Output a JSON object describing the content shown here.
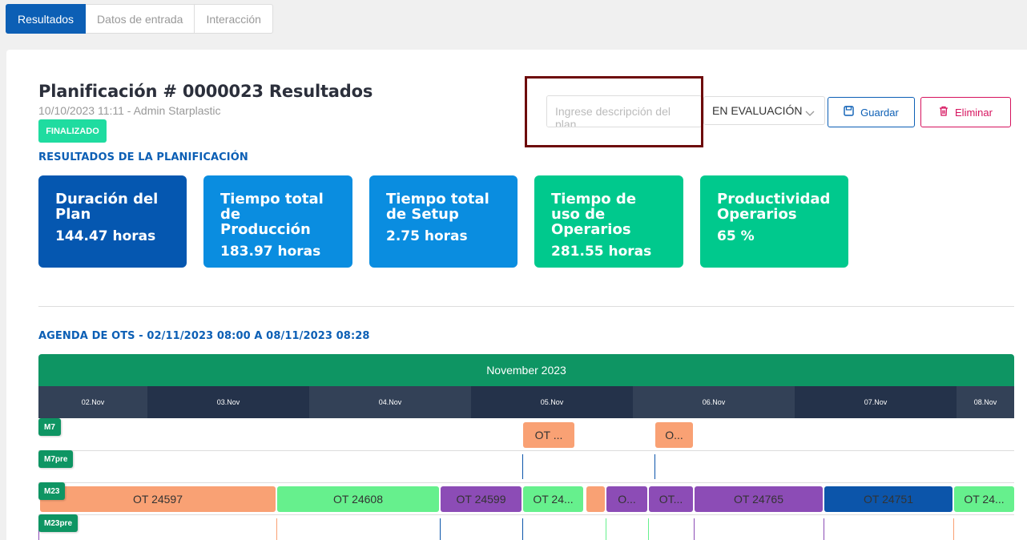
{
  "tabs": [
    {
      "label": "Resultados"
    },
    {
      "label": "Datos de entrada"
    },
    {
      "label": "Interacción"
    }
  ],
  "header": {
    "title": "Planificación # 0000023 Resultados",
    "subtitle": "10/10/2023 11:11 - Admin Starplastic",
    "badge": "FINALIZADO"
  },
  "description": {
    "placeholder": "Ingrese descripción del plan",
    "value": ""
  },
  "status_select": {
    "value": "EN EVALUACIÓN"
  },
  "buttons": {
    "save": "Guardar",
    "delete": "Eliminar"
  },
  "results": {
    "section_label": "RESULTADOS DE LA PLANIFICACIÓN",
    "cards": [
      {
        "title": "Duración del Plan",
        "value": "144.47 horas",
        "color": "#0557b0"
      },
      {
        "title": "Tiempo total de Producción",
        "value": "183.97 horas",
        "color": "#0a8de0"
      },
      {
        "title": "Tiempo total de Setup",
        "value": "2.75 horas",
        "color": "#0a8de0"
      },
      {
        "title": "Tiempo de uso de Operarios",
        "value": "281.55 horas",
        "color": "#00c98d"
      },
      {
        "title": "Productividad Operarios",
        "value": "65 %",
        "color": "#00c98d"
      }
    ]
  },
  "agenda": {
    "section_label": "AGENDA DE OTS - 02/11/2023 08:00 A 08/11/2023 08:28",
    "month": "November 2023",
    "days": [
      "02.Nov",
      "03.Nov",
      "04.Nov",
      "05.Nov",
      "06.Nov",
      "07.Nov",
      "08.Nov"
    ],
    "machines": [
      "M7",
      "M7pre",
      "M23",
      "M23pre"
    ],
    "m7_bars": [
      "OT ...",
      "O..."
    ],
    "m23_bars": [
      "OT 24597",
      "OT 24608",
      "OT 24599",
      "OT 24...",
      "",
      "O...",
      "OT...",
      "OT 24765",
      "OT 24751",
      "OT 24..."
    ]
  },
  "colors": {
    "primary": "#0c5fb5",
    "success_badge": "#1fdca0",
    "danger": "#d6135e",
    "gantt_header": "#0e9563",
    "bar_orange": "#f9a174",
    "bar_green": "#66f08d",
    "bar_purple": "#8c4cb6",
    "bar_blue": "#0c55aa"
  }
}
